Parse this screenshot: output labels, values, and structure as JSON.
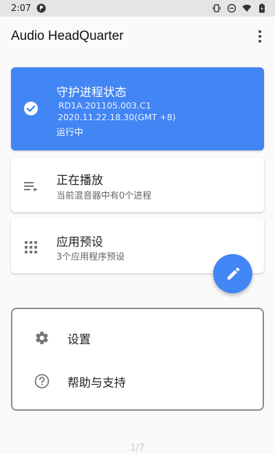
{
  "status_bar": {
    "time": "2:07",
    "icons": [
      "notification-app-icon",
      "vibrate-icon",
      "do-not-disturb-icon",
      "wifi-icon",
      "battery-icon"
    ]
  },
  "app_bar": {
    "title": "Audio HeadQuarter",
    "menu_icon": "more-vert-icon"
  },
  "cards": {
    "status": {
      "title": "守护进程状态",
      "build": "RD1A.201105.003.C1",
      "date": "2020.11.22.18.30(GMT +8)",
      "state": "运行中",
      "icon": "check-circle-icon",
      "color": "#4285f4"
    },
    "playing": {
      "title": "正在播放",
      "subtitle": "当前混音器中有0个进程",
      "icon": "playlist-icon"
    },
    "presets": {
      "title": "应用预设",
      "subtitle": "3个应用程序预设",
      "icon": "apps-grid-icon"
    }
  },
  "fab": {
    "icon": "edit-pencil-icon",
    "color": "#4285f4"
  },
  "menu": {
    "items": [
      {
        "label": "设置",
        "icon": "gear-icon"
      },
      {
        "label": "帮助与支持",
        "icon": "help-circle-icon"
      }
    ]
  },
  "page_indicator": "1/7"
}
